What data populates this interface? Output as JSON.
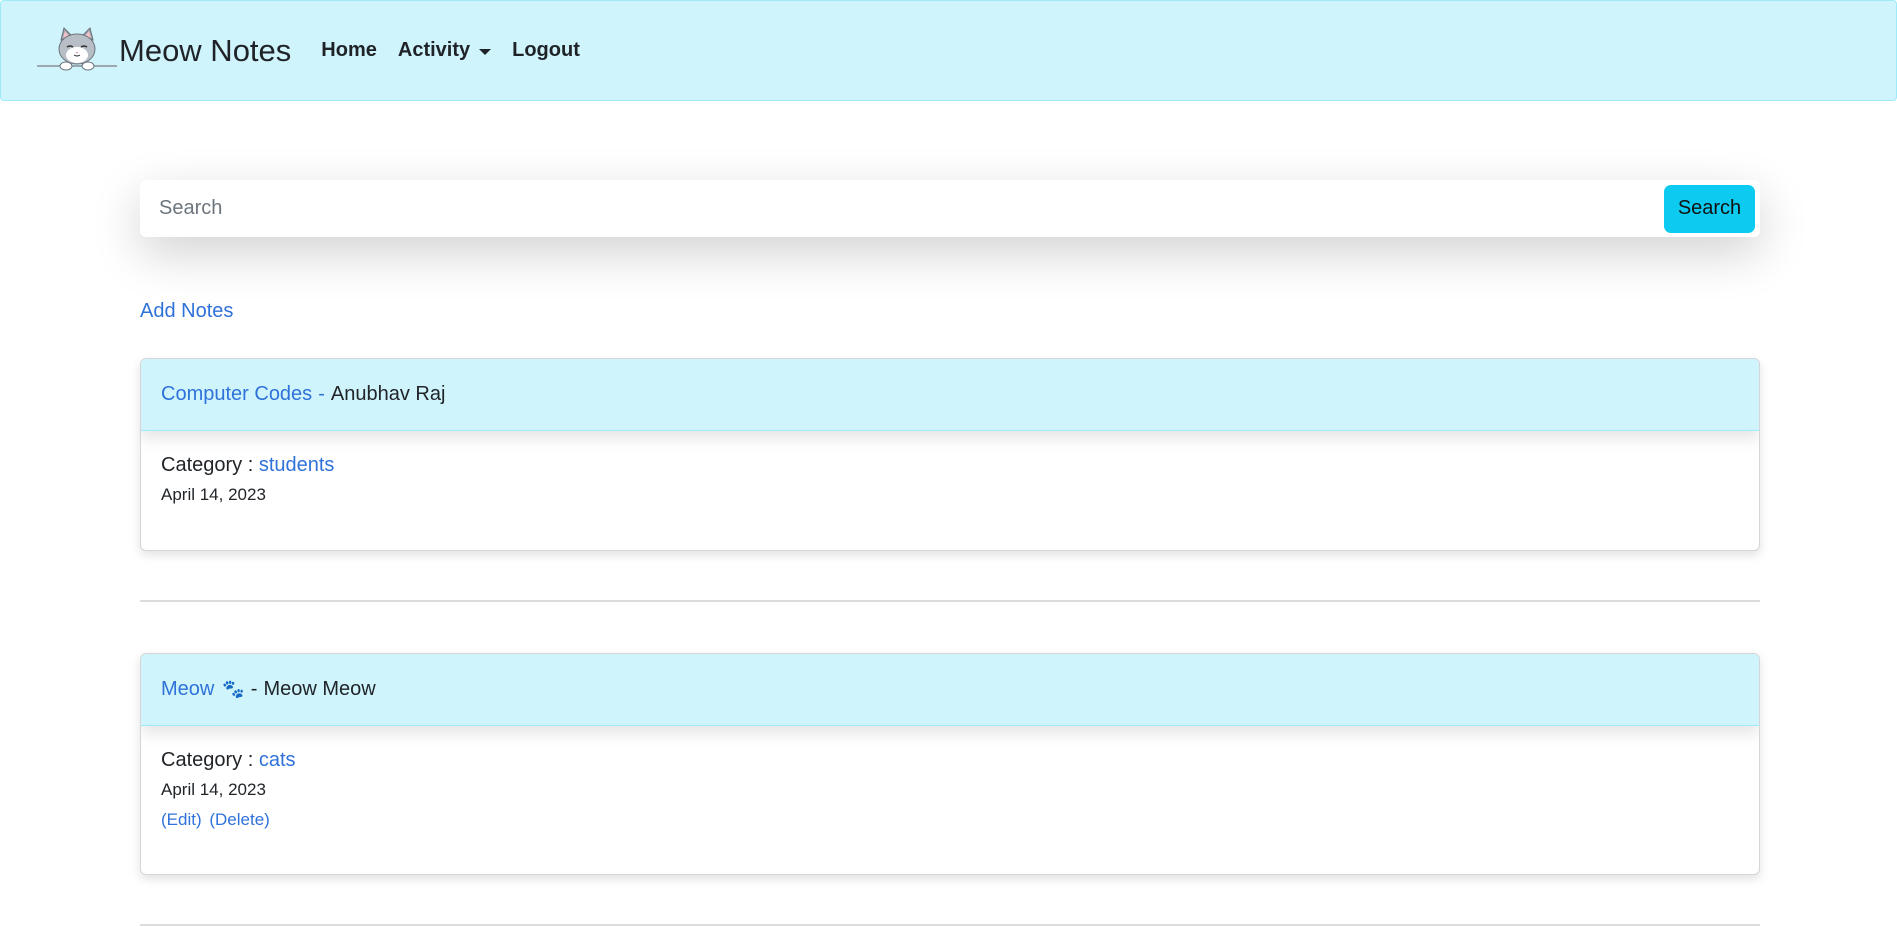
{
  "navbar": {
    "brand": "Meow Notes",
    "links": {
      "home": "Home",
      "activity": "Activity",
      "logout": "Logout"
    }
  },
  "search": {
    "placeholder": "Search",
    "button": "Search"
  },
  "add_notes": "Add Notes",
  "notes": [
    {
      "title": "Computer Codes",
      "separator": "-",
      "author": "Anubhav Raj",
      "category_label": "Category :",
      "category": "students",
      "date": "April 14, 2023"
    },
    {
      "title": "Meow",
      "separator": "-",
      "author": "Meow Meow",
      "category_label": "Category :",
      "category": "cats",
      "date": "April 14, 2023",
      "edit": "(Edit)",
      "delete": "(Delete)"
    }
  ],
  "colors": {
    "navbar_bg": "#cff4fc",
    "accent": "#0dcaf0",
    "link": "#2f72d9"
  }
}
